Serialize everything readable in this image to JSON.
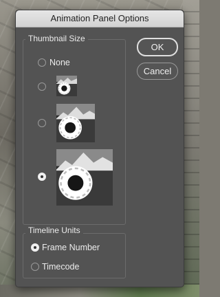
{
  "dialog": {
    "title": "Animation Panel Options",
    "ok_label": "OK",
    "cancel_label": "Cancel"
  },
  "thumbnail_size": {
    "legend": "Thumbnail Size",
    "options": [
      {
        "label": "None",
        "selected": false
      },
      {
        "size": "small",
        "selected": false
      },
      {
        "size": "medium",
        "selected": false
      },
      {
        "size": "large",
        "selected": true
      }
    ]
  },
  "timeline_units": {
    "legend": "Timeline Units",
    "options": [
      {
        "label": "Frame Number",
        "selected": true
      },
      {
        "label": "Timecode",
        "selected": false
      }
    ]
  }
}
